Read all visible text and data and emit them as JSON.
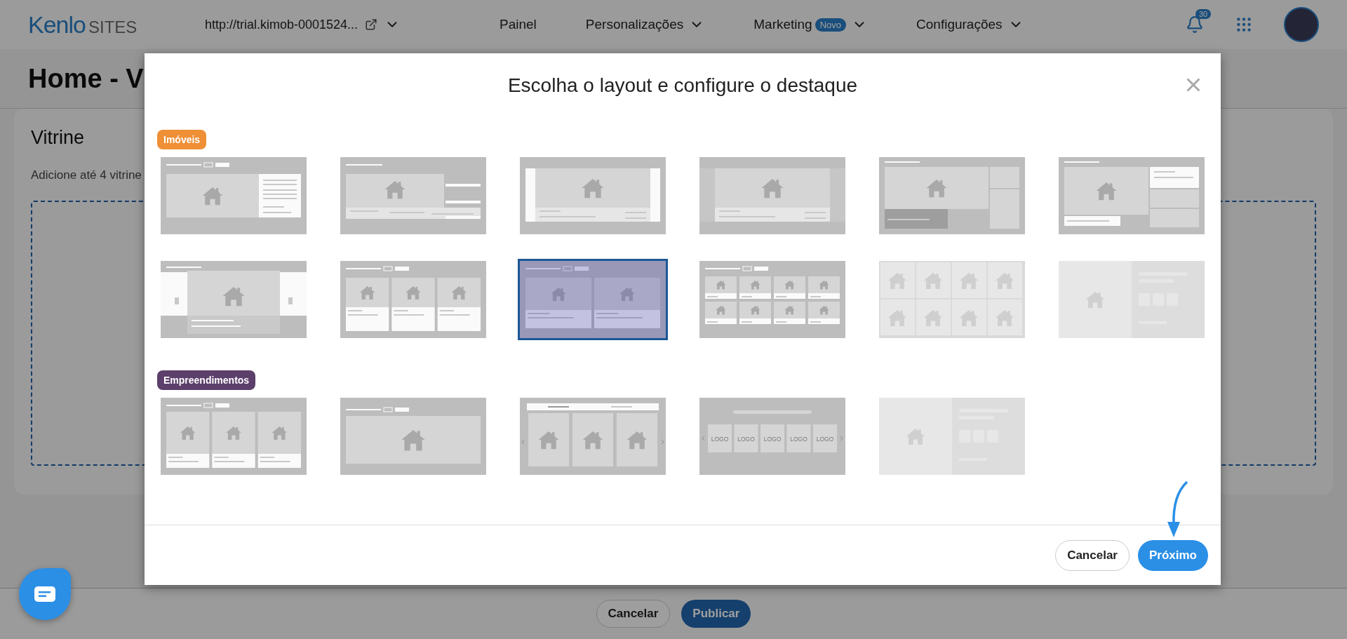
{
  "header": {
    "logo": {
      "brand": "Kenlo",
      "product": "SITES"
    },
    "site_url": "http://trial.kimob-0001524...",
    "nav": [
      {
        "label": "Painel",
        "dropdown": false
      },
      {
        "label": "Personalizações",
        "dropdown": true
      },
      {
        "label": "Marketing",
        "badge": "Novo",
        "dropdown": true
      },
      {
        "label": "Configurações",
        "dropdown": true
      }
    ],
    "notifications": "30"
  },
  "page": {
    "title": "Home - V",
    "card": {
      "title": "Vitrine",
      "description": "Adicione até 4 vitrine"
    }
  },
  "footer": {
    "buttons": [
      {
        "label": "Cancelar",
        "kind": "secondary"
      },
      {
        "label": "Publicar",
        "kind": "primary"
      }
    ]
  },
  "modal": {
    "title": "Escolha o layout e configure o destaque",
    "sections": [
      {
        "label": "Imóveis",
        "color": "#ef8f36",
        "layouts": [
          {
            "kind": "hero-panel",
            "selected": false,
            "disabled": false
          },
          {
            "kind": "hero-list",
            "selected": false,
            "disabled": false
          },
          {
            "kind": "banner",
            "selected": false,
            "disabled": false
          },
          {
            "kind": "banner-peek",
            "selected": false,
            "disabled": false
          },
          {
            "kind": "hero-stack",
            "selected": false,
            "disabled": false
          },
          {
            "kind": "hero-side",
            "selected": false,
            "disabled": false
          },
          {
            "kind": "slider",
            "selected": false,
            "disabled": false
          },
          {
            "kind": "cards-3",
            "selected": false,
            "disabled": false
          },
          {
            "kind": "cards-2",
            "selected": true,
            "disabled": false
          },
          {
            "kind": "cards-8",
            "selected": false,
            "disabled": false
          },
          {
            "kind": "grid-8",
            "selected": false,
            "disabled": true
          },
          {
            "kind": "split",
            "selected": false,
            "disabled": true
          }
        ]
      },
      {
        "label": "Empreendimentos",
        "color": "#5c3f6b",
        "layouts": [
          {
            "kind": "cards-3-tall",
            "selected": false,
            "disabled": false
          },
          {
            "kind": "wide",
            "selected": false,
            "disabled": false
          },
          {
            "kind": "tabs-3",
            "selected": false,
            "disabled": false
          },
          {
            "kind": "logos",
            "selected": false,
            "disabled": false,
            "labels": [
              "LOGO",
              "LOGO",
              "LOGO",
              "LOGO",
              "LOGO"
            ]
          },
          {
            "kind": "split",
            "selected": false,
            "disabled": true
          }
        ]
      }
    ],
    "buttons": [
      {
        "label": "Cancelar",
        "kind": "secondary"
      },
      {
        "label": "Próximo",
        "kind": "primary"
      }
    ]
  }
}
